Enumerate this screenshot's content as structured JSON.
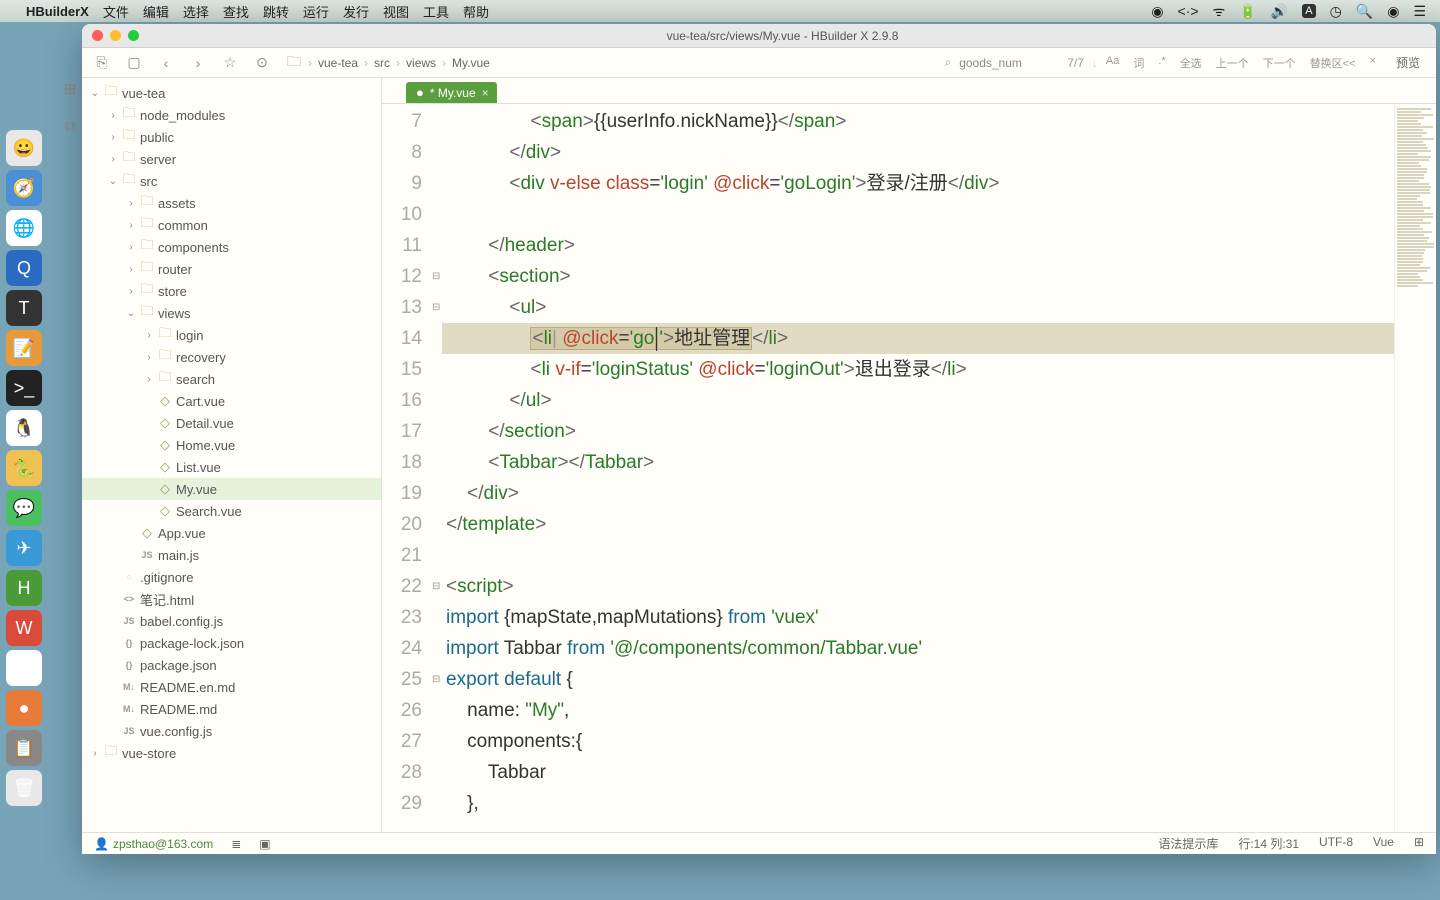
{
  "menubar": {
    "app": "HBuilderX",
    "items": [
      "文件",
      "编辑",
      "选择",
      "查找",
      "跳转",
      "运行",
      "发行",
      "视图",
      "工具",
      "帮助"
    ]
  },
  "window": {
    "title": "vue-tea/src/views/My.vue - HBuilder X 2.9.8"
  },
  "toolbar": {
    "breadcrumb": [
      "vue-tea",
      "src",
      "views",
      "My.vue"
    ],
    "search_ph": "goods_num",
    "counter": "7/7",
    "opts": [
      "Aa",
      "词",
      ".*",
      "全选",
      "上一个",
      "下一个",
      "替换区<<",
      "×"
    ],
    "preview": "预览"
  },
  "tab": {
    "name": "* My.vue"
  },
  "tree": {
    "root1": "vue-tea",
    "nodes": [
      {
        "d": 1,
        "t": "f",
        "n": "node_modules",
        "c": ">"
      },
      {
        "d": 1,
        "t": "f",
        "n": "public",
        "c": ">"
      },
      {
        "d": 1,
        "t": "f",
        "n": "server",
        "c": ">"
      },
      {
        "d": 1,
        "t": "f",
        "n": "src",
        "c": "v"
      },
      {
        "d": 2,
        "t": "f",
        "n": "assets",
        "c": ">"
      },
      {
        "d": 2,
        "t": "f",
        "n": "common",
        "c": ">"
      },
      {
        "d": 2,
        "t": "f",
        "n": "components",
        "c": ">"
      },
      {
        "d": 2,
        "t": "f",
        "n": "router",
        "c": ">"
      },
      {
        "d": 2,
        "t": "f",
        "n": "store",
        "c": ">"
      },
      {
        "d": 2,
        "t": "f",
        "n": "views",
        "c": "v"
      },
      {
        "d": 3,
        "t": "f",
        "n": "login",
        "c": ">"
      },
      {
        "d": 3,
        "t": "f",
        "n": "recovery",
        "c": ">"
      },
      {
        "d": 3,
        "t": "f",
        "n": "search",
        "c": ">"
      },
      {
        "d": 3,
        "t": "v",
        "n": "Cart.vue"
      },
      {
        "d": 3,
        "t": "v",
        "n": "Detail.vue"
      },
      {
        "d": 3,
        "t": "v",
        "n": "Home.vue"
      },
      {
        "d": 3,
        "t": "v",
        "n": "List.vue"
      },
      {
        "d": 3,
        "t": "v",
        "n": "My.vue",
        "active": true
      },
      {
        "d": 3,
        "t": "v",
        "n": "Search.vue"
      },
      {
        "d": 2,
        "t": "v",
        "n": "App.vue"
      },
      {
        "d": 2,
        "t": "j",
        "n": "main.js"
      },
      {
        "d": 1,
        "t": "g",
        "n": ".gitignore"
      },
      {
        "d": 1,
        "t": "h",
        "n": "笔记.html"
      },
      {
        "d": 1,
        "t": "j",
        "n": "babel.config.js"
      },
      {
        "d": 1,
        "t": "o",
        "n": "package-lock.json"
      },
      {
        "d": 1,
        "t": "o",
        "n": "package.json"
      },
      {
        "d": 1,
        "t": "m",
        "n": "README.en.md"
      },
      {
        "d": 1,
        "t": "m",
        "n": "README.md"
      },
      {
        "d": 1,
        "t": "j",
        "n": "vue.config.js"
      }
    ],
    "root2": "vue-store"
  },
  "code": {
    "start": 7,
    "lines": [
      {
        "html": "                <span class='pn'>&lt;</span><span class='tg'>span</span><span class='pn'>&gt;</span>{{userInfo<span class='cm'>.</span>nickName}}<span class='pn'>&lt;/</span><span class='tg'>span</span><span class='pn'>&gt;</span>"
      },
      {
        "html": "            <span class='pn'>&lt;/</span><span class='tg'>div</span><span class='pn'>&gt;</span>"
      },
      {
        "html": "            <span class='pn'>&lt;</span><span class='tg'>div</span> <span class='at'>v-else</span> <span class='at'>class</span>=<span class='av'>'login'</span> <span class='ev'>@click</span>=<span class='av'>'goLogin'</span><span class='pn'>&gt;</span>登录/注册<span class='pn'>&lt;/</span><span class='tg'>div</span><span class='pn'>&gt;</span>"
      },
      {
        "html": ""
      },
      {
        "html": "        <span class='pn'>&lt;/</span><span class='tg'>header</span><span class='pn'>&gt;</span>"
      },
      {
        "html": "        <span class='pn'>&lt;</span><span class='tg'>section</span><span class='pn'>&gt;</span>",
        "fold": "⊟"
      },
      {
        "html": "            <span class='pn'>&lt;</span><span class='tg'>ul</span><span class='pn'>&gt;</span>",
        "fold": "⊟"
      },
      {
        "html": "                <span class='hl-box'><span class='pn'>&lt;</span><span class='tg'>li</span><span style='color:#999'>|</span> <span class='ev'>@click</span>=<span class='av'>'go</span></span><span class='cursor'></span><span class='hl-box'><span class='av'>'</span><span class='pn'>&gt;</span>地址管理</span><span class='pn'>&lt;/</span><span class='tg'>li</span><span class='pn'>&gt;</span>",
        "hl": true
      },
      {
        "html": "                <span class='pn'>&lt;</span><span class='tg'>li</span> <span class='at'>v-if</span>=<span class='av'>'loginStatus'</span> <span class='ev'>@click</span>=<span class='av'>'loginOut'</span><span class='pn'>&gt;</span>退出登录<span class='pn'>&lt;/</span><span class='tg'>li</span><span class='pn'>&gt;</span>"
      },
      {
        "html": "            <span class='pn'>&lt;/</span><span class='tg'>ul</span><span class='pn'>&gt;</span>"
      },
      {
        "html": "        <span class='pn'>&lt;/</span><span class='tg'>section</span><span class='pn'>&gt;</span>"
      },
      {
        "html": "        <span class='pn'>&lt;</span><span class='tg'>Tabbar</span><span class='pn'>&gt;&lt;/</span><span class='tg'>Tabbar</span><span class='pn'>&gt;</span>"
      },
      {
        "html": "    <span class='pn'>&lt;/</span><span class='tg'>div</span><span class='pn'>&gt;</span>"
      },
      {
        "html": "<span class='pn'>&lt;/</span><span class='tg'>template</span><span class='pn'>&gt;</span>"
      },
      {
        "html": ""
      },
      {
        "html": "<span class='pn'>&lt;</span><span class='tg'>script</span><span class='pn'>&gt;</span>",
        "fold": "⊟"
      },
      {
        "html": "<span class='kw'>import</span> {mapState,mapMutations} <span class='kw'>from</span> <span class='av'>'vuex'</span>"
      },
      {
        "html": "<span class='kw'>import</span> Tabbar <span class='kw'>from</span> <span class='av'>'@/components/common/Tabbar.vue'</span>"
      },
      {
        "html": "<span class='kw'>export</span> <span class='kw'>default</span> {",
        "fold": "⊟"
      },
      {
        "html": "    <span class='fn'>name</span>: <span class='av'>\"My\"</span>,"
      },
      {
        "html": "    <span class='fn'>components</span>:{"
      },
      {
        "html": "        Tabbar"
      },
      {
        "html": "    },"
      }
    ]
  },
  "status": {
    "user": "zpsthao@163.com",
    "syntax": "语法提示库",
    "pos": "行:14  列:31",
    "enc": "UTF-8",
    "lang": "Vue"
  },
  "dock_icons": [
    {
      "c": "#e8e8e8",
      "t": "😀"
    },
    {
      "c": "#4a8fd8",
      "t": "🧭"
    },
    {
      "c": "#fff",
      "t": "🌐"
    },
    {
      "c": "#2a6abf",
      "t": "Q"
    },
    {
      "c": "#333",
      "t": "T"
    },
    {
      "c": "#e89a3a",
      "t": "📝"
    },
    {
      "c": "#222",
      "t": ">_"
    },
    {
      "c": "#fff",
      "t": "🐧"
    },
    {
      "c": "#f0c050",
      "t": "🐍"
    },
    {
      "c": "#4ac060",
      "t": "💬"
    },
    {
      "c": "#3a9ad8",
      "t": "✈"
    },
    {
      "c": "#4a9a3a",
      "t": "H"
    },
    {
      "c": "#d84a3a",
      "t": "W"
    },
    {
      "c": "#fff",
      "t": "∞"
    },
    {
      "c": "#e87a3a",
      "t": "●"
    },
    {
      "c": "#888",
      "t": "📋"
    },
    {
      "c": "#e8e8e8",
      "t": "🗑"
    }
  ]
}
